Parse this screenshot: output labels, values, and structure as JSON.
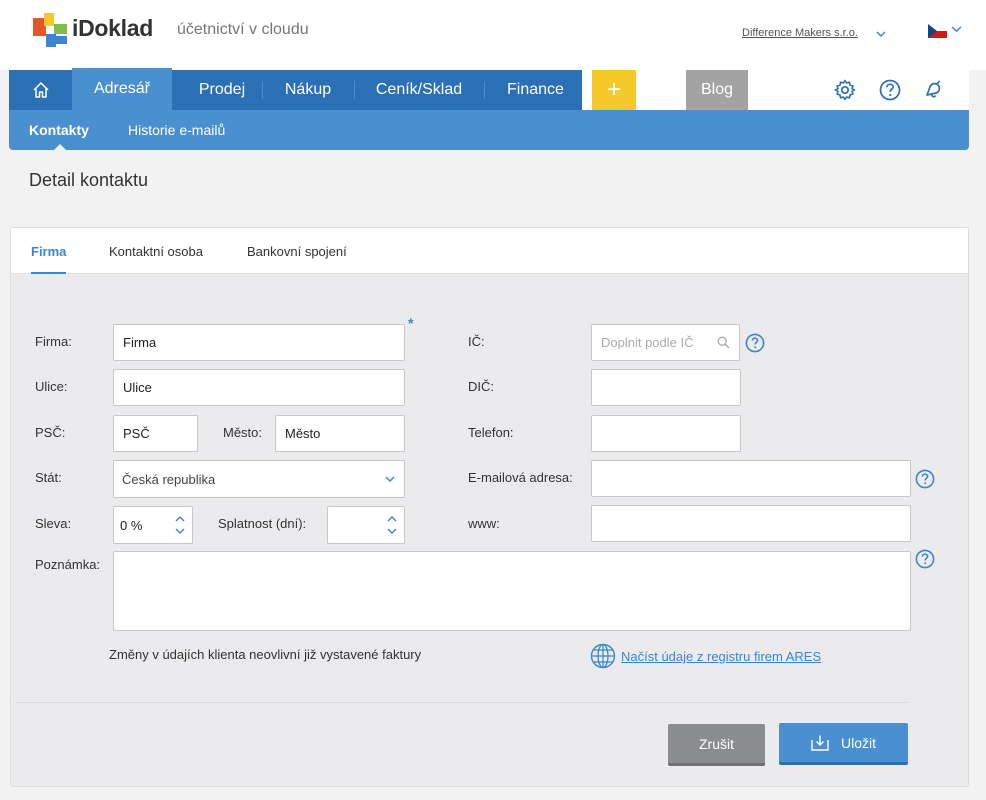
{
  "header": {
    "logo_text": "iDoklad",
    "tagline": "účetnictví v cloudu",
    "company": "Difference Makers s.r.o."
  },
  "nav": {
    "items": [
      "Adresář",
      "Prodej",
      "Nákup",
      "Ceník/Sklad",
      "Finance"
    ],
    "plus": "+",
    "blog": "Blog"
  },
  "subnav": {
    "items": [
      "Kontakty",
      "Historie e-mailů"
    ]
  },
  "page_title": "Detail kontaktu",
  "tabs": [
    "Firma",
    "Kontaktní osoba",
    "Bankovní spojení"
  ],
  "form": {
    "firma": {
      "label": "Firma:",
      "value": "Firma"
    },
    "ulice": {
      "label": "Ulice:",
      "value": "Ulice"
    },
    "psc": {
      "label": "PSČ:",
      "value": "PSČ"
    },
    "mesto": {
      "label": "Město:",
      "value": "Město"
    },
    "stat": {
      "label": "Stát:",
      "value": "Česká republika"
    },
    "sleva": {
      "label": "Sleva:",
      "value": "0 %"
    },
    "splatnost": {
      "label": "Splatnost (dní):",
      "value": ""
    },
    "poznamka": {
      "label": "Poznámka:",
      "value": ""
    },
    "ic": {
      "label": "IČ:",
      "placeholder": "Doplnit podle IČ"
    },
    "dic": {
      "label": "DIČ:",
      "value": ""
    },
    "telefon": {
      "label": "Telefon:",
      "value": ""
    },
    "email": {
      "label": "E-mailová adresa:",
      "value": ""
    },
    "www": {
      "label": "www:",
      "value": ""
    },
    "required_mark": "*"
  },
  "note": "Změny v údajích klienta neovlivní již vystavené faktury",
  "ares_link": "Načíst údaje z registru firem ARES",
  "buttons": {
    "cancel": "Zrušit",
    "save": "Uložit"
  },
  "colors": {
    "primary": "#2b6fb5",
    "accent": "#4a8fd0",
    "plus": "#f6c92a",
    "blog": "#a3a3a3"
  }
}
